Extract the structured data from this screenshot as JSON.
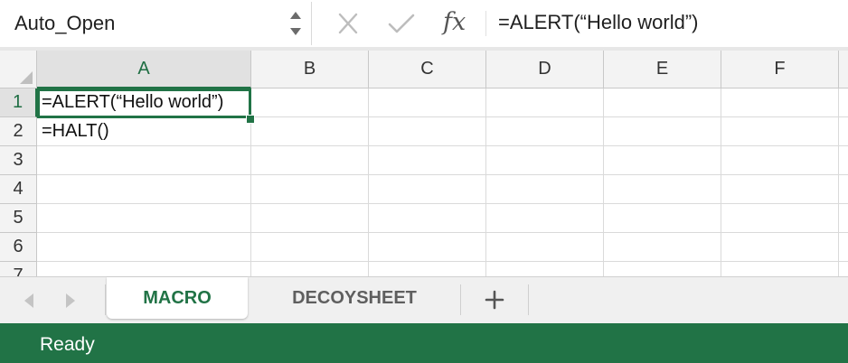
{
  "formula_bar": {
    "name_box": "Auto_Open",
    "fx_label": "fx",
    "formula": "=ALERT(“Hello world”)"
  },
  "grid": {
    "columns": [
      "A",
      "B",
      "C",
      "D",
      "E",
      "F"
    ],
    "rows": [
      "1",
      "2",
      "3",
      "4",
      "5",
      "6",
      "7"
    ],
    "cells": {
      "A1": "=ALERT(“Hello world”)",
      "A2": "=HALT()"
    },
    "active_cell": "A1"
  },
  "sheet_tabs": {
    "tabs": [
      {
        "label": "MACRO",
        "active": true
      },
      {
        "label": "DECOYSHEET",
        "active": false
      }
    ],
    "add_label": "+"
  },
  "status_bar": {
    "status": "Ready"
  },
  "colors": {
    "accent": "#217346",
    "status_bar_bg": "#217346",
    "header_bg": "#f3f3f3"
  },
  "icons": [
    "chevron-up-icon",
    "chevron-down-icon",
    "cancel-x-icon",
    "checkmark-icon",
    "fx-icon",
    "tab-prev-icon",
    "tab-next-icon",
    "plus-icon"
  ]
}
